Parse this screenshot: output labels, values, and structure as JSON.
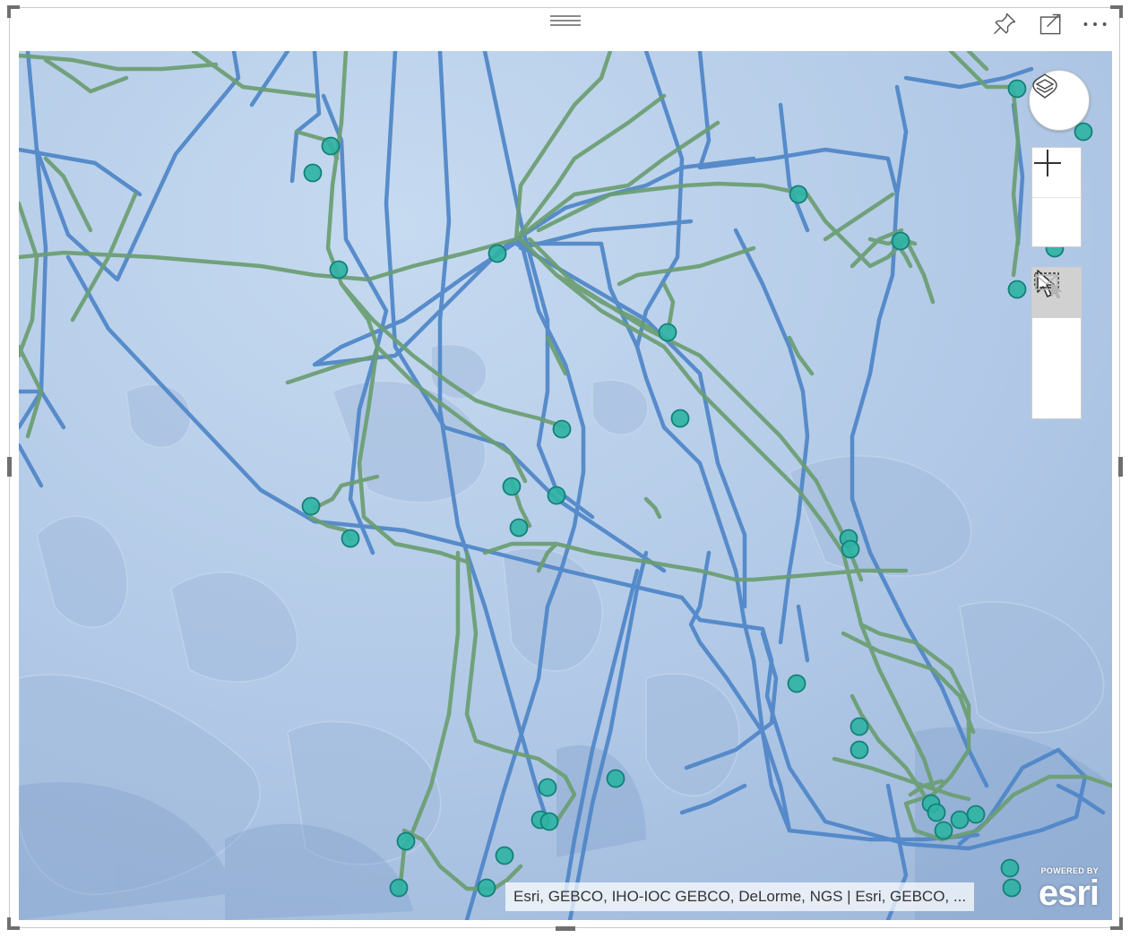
{
  "visual_header": {
    "drag_handle_icon": "drag-handle-icon",
    "pin_icon": "pin-icon",
    "focus_mode_icon": "focus-mode-icon",
    "more_options_icon": "more-options-icon"
  },
  "map": {
    "basemap": "Ocean (hillshade, light blue)",
    "colors": {
      "blue_lines": "#4f86c8",
      "green_lines": "#6b9e72",
      "points_fill": "#2db2a3",
      "points_stroke": "#138078",
      "water": "#b9cde6"
    },
    "attribution": "Esri, GEBCO, IHO-IOC GEBCO, DeLorme, NGS | Esri, GEBCO, ...",
    "logo": {
      "powered_by": "POWERED BY",
      "brand": "esri"
    }
  },
  "controls": {
    "basemap_toggle_icon": "layers-icon",
    "zoom_in_icon": "plus-icon",
    "zoom_out_icon": "minus-icon",
    "pointer_select_icon": "cursor-icon",
    "rect_select_icon": "rectangle-select-icon",
    "lasso_select_icon": "reference-layer-select-icon"
  }
}
